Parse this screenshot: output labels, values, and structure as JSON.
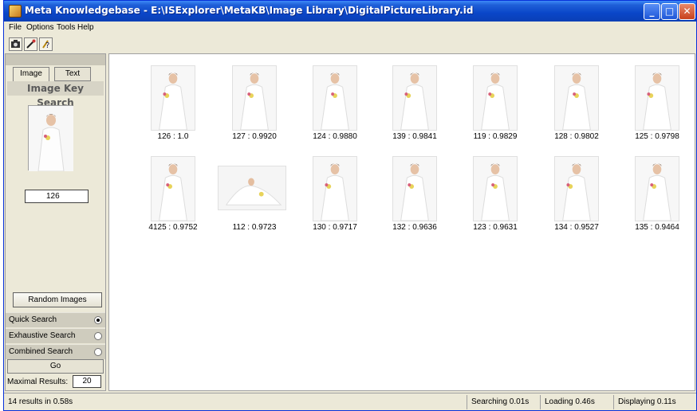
{
  "window": {
    "title": "Meta Knowledgebase - E:\\ISExplorer\\MetaKB\\Image Library\\DigitalPictureLibrary.id",
    "minimize": "_",
    "maximize": "□",
    "close": "✕"
  },
  "menu": [
    "File",
    "Options",
    "Tools",
    "Help"
  ],
  "toolbar": {
    "camera_icon": "camera-icon",
    "tools_icon": "tools-icon",
    "help_icon": "help-icon"
  },
  "left_panel": {
    "tabs": [
      "Image",
      "Text"
    ],
    "heading": "Image Key Search",
    "key_id": "126",
    "random_button": "Random Images",
    "search_modes": [
      {
        "label": "Quick Search",
        "checked": true
      },
      {
        "label": "Exhaustive Search",
        "checked": false
      },
      {
        "label": "Combined Search",
        "checked": false
      }
    ],
    "go_button": "Go",
    "max_results_label": "Maximal Results:",
    "max_results_value": "20"
  },
  "results": [
    {
      "caption": "126 : 1.0"
    },
    {
      "caption": "127 : 0.9920"
    },
    {
      "caption": "124 : 0.9880"
    },
    {
      "caption": "139 : 0.9841"
    },
    {
      "caption": "119 : 0.9829"
    },
    {
      "caption": "128 : 0.9802"
    },
    {
      "caption": "125 : 0.9798"
    },
    {
      "caption": "4125 : 0.9752"
    },
    {
      "caption": "112 : 0.9723",
      "wide": true
    },
    {
      "caption": "130 : 0.9717"
    },
    {
      "caption": "132 : 0.9636"
    },
    {
      "caption": "123 : 0.9631"
    },
    {
      "caption": "134 : 0.9527"
    },
    {
      "caption": "135 : 0.9464"
    }
  ],
  "status": {
    "results": "14 results in 0.58s",
    "searching": "Searching 0.01s",
    "loading": "Loading 0.46s",
    "displaying": "Displaying 0.11s"
  }
}
